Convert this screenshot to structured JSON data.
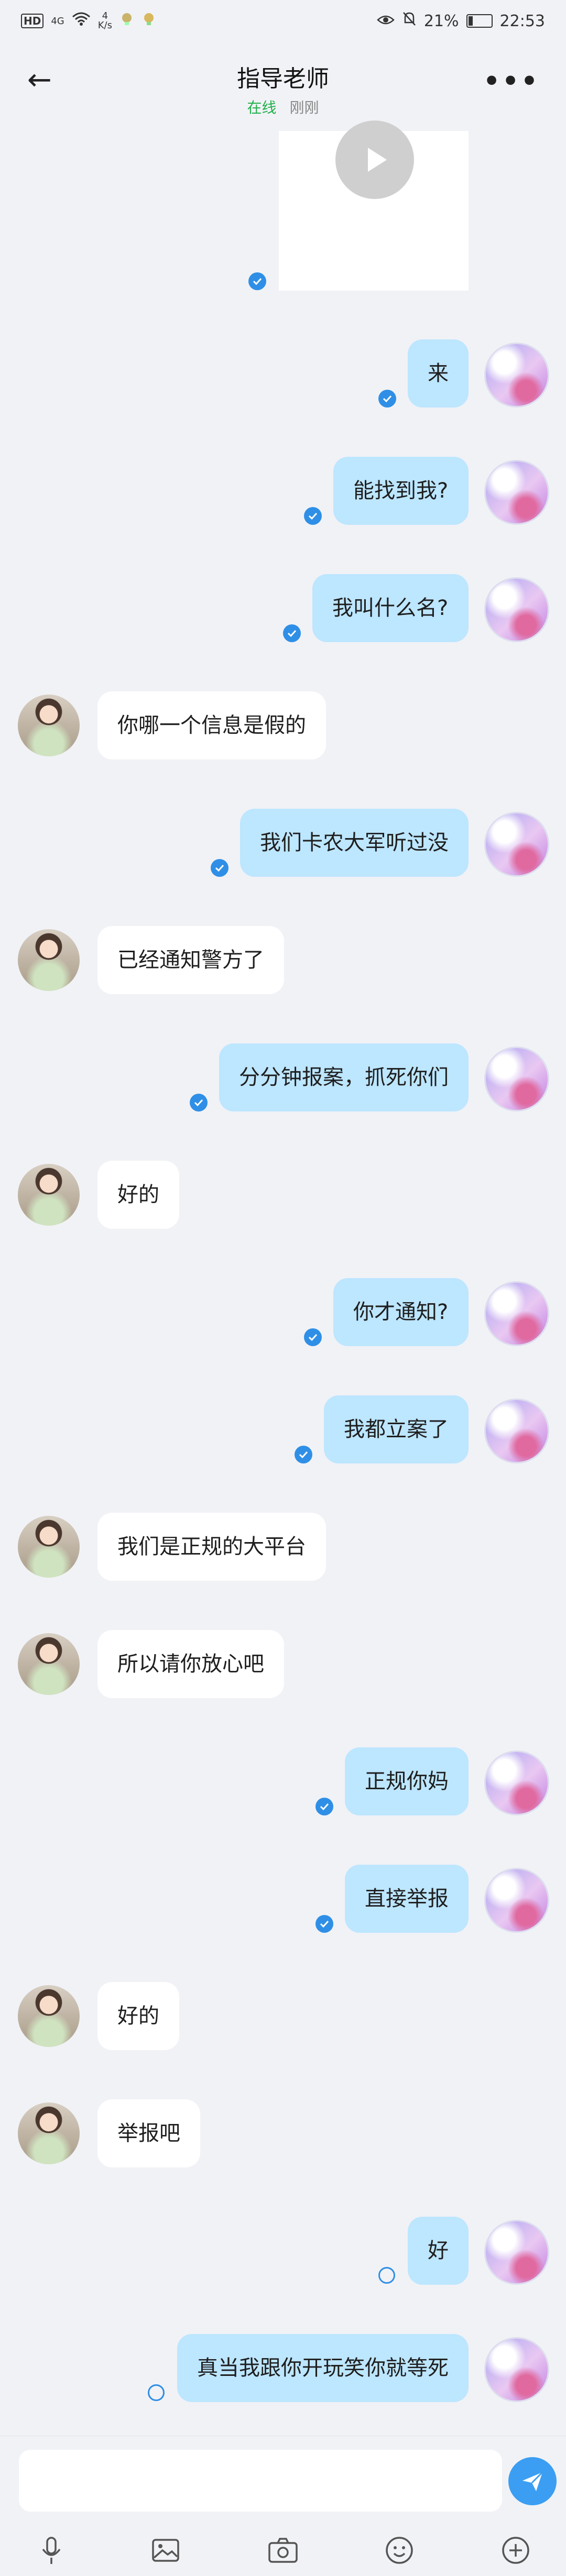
{
  "status": {
    "network": "4G",
    "speed_value": "4",
    "speed_unit": "K/s",
    "battery": "21%",
    "time": "22:53",
    "hd": "HD"
  },
  "header": {
    "back": "←",
    "title": "指导老师",
    "online": "在线",
    "last_seen": "刚刚",
    "more": "•••"
  },
  "messages": [
    {
      "side": "out",
      "text": "来",
      "status": "read"
    },
    {
      "side": "out",
      "text": "能找到我?",
      "status": "read"
    },
    {
      "side": "out",
      "text": "我叫什么名?",
      "status": "read"
    },
    {
      "side": "in",
      "text": "你哪一个信息是假的"
    },
    {
      "side": "out",
      "text": "我们卡农大军听过没",
      "status": "read"
    },
    {
      "side": "in",
      "text": "已经通知警方了"
    },
    {
      "side": "out",
      "text": "分分钟报案，抓死你们",
      "status": "read"
    },
    {
      "side": "in",
      "text": "好的"
    },
    {
      "side": "out",
      "text": "你才通知?",
      "status": "read"
    },
    {
      "side": "out",
      "text": "我都立案了",
      "status": "read"
    },
    {
      "side": "in",
      "text": "我们是正规的大平台"
    },
    {
      "side": "in",
      "text": "所以请你放心吧"
    },
    {
      "side": "out",
      "text": "正规你妈",
      "status": "read"
    },
    {
      "side": "out",
      "text": "直接举报",
      "status": "read"
    },
    {
      "side": "in",
      "text": "好的"
    },
    {
      "side": "in",
      "text": "举报吧"
    },
    {
      "side": "out",
      "text": "好",
      "status": "sending"
    },
    {
      "side": "out",
      "text": "真当我跟你开玩笑你就等死",
      "status": "sending"
    }
  ],
  "input": {
    "placeholder": ""
  },
  "tools": [
    "mic-icon",
    "image-icon",
    "camera-icon",
    "emoji-icon",
    "plus-icon"
  ],
  "colors": {
    "accent": "#3b9ef2",
    "outgoing_bubble": "#bde6ff",
    "incoming_bubble": "#ffffff",
    "online": "#22b14c"
  }
}
